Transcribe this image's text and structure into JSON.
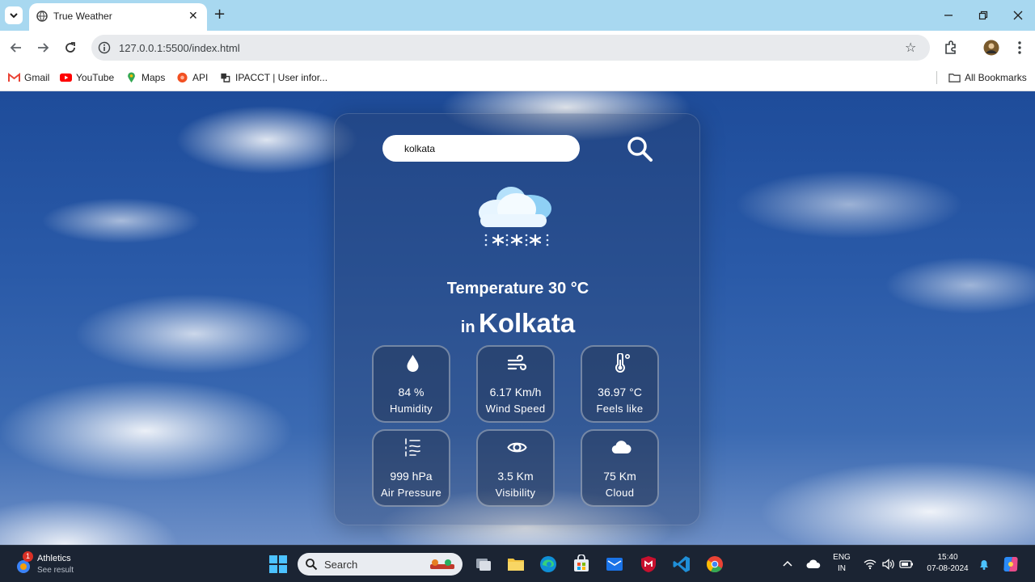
{
  "browser": {
    "tab_title": "True Weather",
    "url": "127.0.0.1:5500/index.html",
    "bookmarks": [
      {
        "label": "Gmail",
        "icon": "gmail-icon"
      },
      {
        "label": "YouTube",
        "icon": "youtube-icon"
      },
      {
        "label": "Maps",
        "icon": "maps-icon"
      },
      {
        "label": "API",
        "icon": "api-icon"
      },
      {
        "label": "IPACCT | User infor...",
        "icon": "ipacct-icon"
      }
    ],
    "all_bookmarks": "All Bookmarks",
    "colors": {
      "tabbar": "#a8d8f0",
      "omnibox": "#e8eaed"
    }
  },
  "app": {
    "search_value": "kolkata",
    "temperature_label": "Temperature 30 °C",
    "city_prefix": "in",
    "city": "Kolkata",
    "weather_icon": "cloud-snow-icon",
    "stats": [
      {
        "value": "84 %",
        "label": "Humidity",
        "icon": "humidity-drop-icon"
      },
      {
        "value": "6.17 Km/h",
        "label": "Wind Speed",
        "icon": "wind-icon"
      },
      {
        "value": "36.97 °C",
        "label": "Feels like",
        "icon": "thermometer-icon"
      },
      {
        "value": "999 hPa",
        "label": "Air Pressure",
        "icon": "pressure-icon"
      },
      {
        "value": "3.5 Km",
        "label": "Visibility",
        "icon": "eye-icon"
      },
      {
        "value": "75 Km",
        "label": "Cloud",
        "icon": "cloud-icon"
      }
    ]
  },
  "taskbar": {
    "widget_title": "Athletics",
    "widget_subtitle": "See result",
    "widget_badge": "1",
    "search_label": "Search",
    "language": "ENG",
    "region": "IN",
    "time": "15:40",
    "date": "07-08-2024"
  }
}
